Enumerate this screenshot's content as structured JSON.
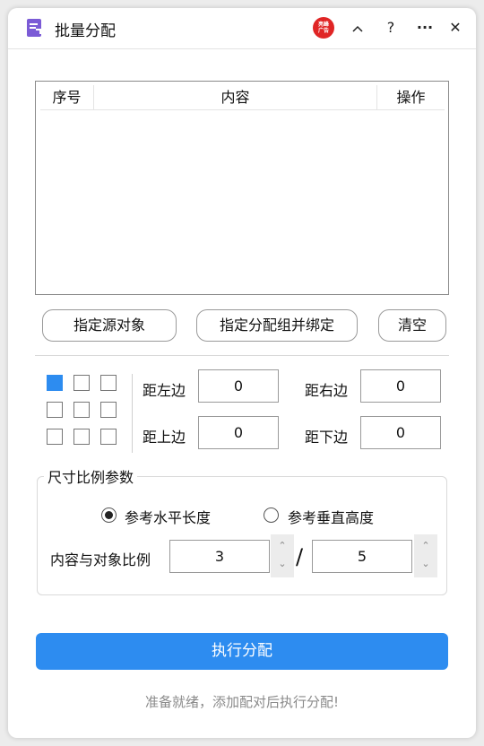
{
  "window": {
    "title": "批量分配",
    "brand_badge": "亮峰\n广告",
    "buttons": {
      "collapse": "^",
      "help": "?",
      "more": "···",
      "close": "✕"
    }
  },
  "table": {
    "columns": [
      "序号",
      "内容",
      "操作"
    ],
    "rows": []
  },
  "actions": {
    "set_source": "指定源对象",
    "set_group": "指定分配组并绑定",
    "clear": "清空"
  },
  "anchor_grid": {
    "selected": "top-left",
    "cells": [
      "top-left",
      "top-center",
      "top-right",
      "middle-left",
      "middle-center",
      "middle-right",
      "bottom-left",
      "bottom-center",
      "bottom-right"
    ]
  },
  "margins": {
    "left_label": "距左边",
    "left_value": "0",
    "right_label": "距右边",
    "right_value": "0",
    "top_label": "距上边",
    "top_value": "0",
    "bottom_label": "距下边",
    "bottom_value": "0"
  },
  "ratio": {
    "group_title": "尺寸比例参数",
    "radio_horizontal": "参考水平长度",
    "radio_vertical": "参考垂直高度",
    "selected": "horizontal",
    "ratio_label": "内容与对象比例",
    "numerator": "3",
    "separator": "/",
    "denominator": "5"
  },
  "execute_label": "执行分配",
  "status_text": "准备就绪，添加配对后执行分配!",
  "colors": {
    "accent": "#2d8cf0",
    "badge": "#e02525",
    "app_icon": "#7b5bd6"
  }
}
